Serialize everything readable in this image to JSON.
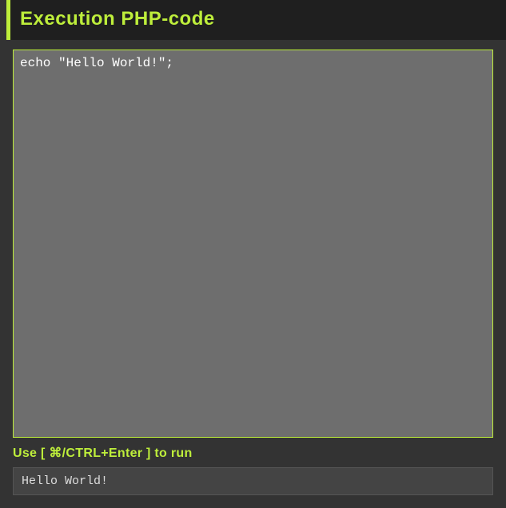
{
  "header": {
    "title": "Execution PHP-code"
  },
  "editor": {
    "code": "echo \"Hello World!\";"
  },
  "hint": {
    "text": "Use [ ⌘/CTRL+Enter ] to run"
  },
  "output": {
    "text": "Hello World!"
  }
}
